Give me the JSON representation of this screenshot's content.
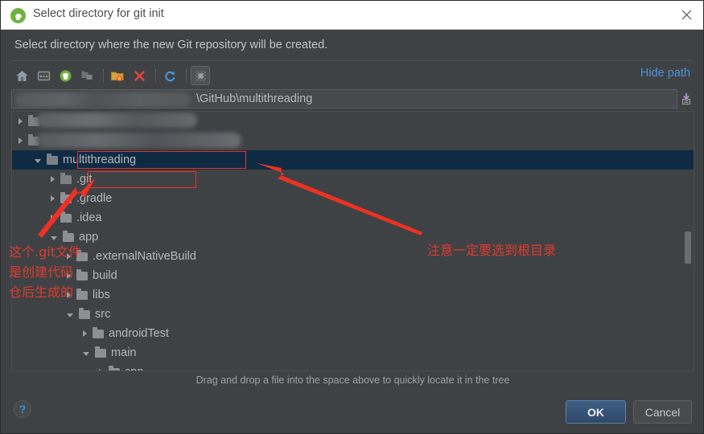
{
  "window": {
    "title": "Select directory for git init",
    "app_icon": "android-studio-icon",
    "close_icon": "close-icon"
  },
  "prompt": "Select directory where the new Git repository will be created.",
  "toolbar": {
    "buttons": [
      {
        "name": "home-icon",
        "tooltip": "Home"
      },
      {
        "name": "desktop-icon",
        "tooltip": "Desktop"
      },
      {
        "name": "project-icon",
        "tooltip": "Project"
      },
      {
        "name": "module-icon",
        "tooltip": "Module"
      },
      {
        "name": "new-folder-icon",
        "tooltip": "New Folder"
      },
      {
        "name": "delete-icon",
        "tooltip": "Delete"
      },
      {
        "name": "refresh-icon",
        "tooltip": "Refresh"
      },
      {
        "name": "show-hidden-icon",
        "tooltip": "Show Hidden Files"
      }
    ],
    "hide_path_label": "Hide path"
  },
  "path": {
    "value": "\\GitHub\\multithreading",
    "redacted_prefix": true,
    "dropdown_icon": "history-dropdown-icon"
  },
  "tree": {
    "rows": [
      {
        "label": "",
        "indent": 0,
        "state": "collapsed",
        "redacted": true,
        "folder": "dim",
        "selected": false
      },
      {
        "label": "",
        "indent": 0,
        "state": "collapsed",
        "redacted": true,
        "folder": "dim",
        "selected": false
      },
      {
        "label": "multithreading",
        "indent": 1,
        "state": "expanded",
        "redacted": false,
        "folder": "dim",
        "selected": true
      },
      {
        "label": ".git",
        "indent": 2,
        "state": "collapsed",
        "redacted": false,
        "folder": "dim",
        "selected": false
      },
      {
        "label": ".gradle",
        "indent": 2,
        "state": "collapsed",
        "redacted": false,
        "folder": "normal",
        "selected": false
      },
      {
        "label": ".idea",
        "indent": 2,
        "state": "collapsed",
        "redacted": false,
        "folder": "normal",
        "selected": false
      },
      {
        "label": "app",
        "indent": 2,
        "state": "expanded",
        "redacted": false,
        "folder": "normal",
        "selected": false
      },
      {
        "label": ".externalNativeBuild",
        "indent": 3,
        "state": "collapsed",
        "redacted": false,
        "folder": "normal",
        "selected": false
      },
      {
        "label": "build",
        "indent": 3,
        "state": "collapsed",
        "redacted": false,
        "folder": "normal",
        "selected": false
      },
      {
        "label": "libs",
        "indent": 3,
        "state": "collapsed",
        "redacted": false,
        "folder": "normal",
        "selected": false
      },
      {
        "label": "src",
        "indent": 3,
        "state": "expanded",
        "redacted": false,
        "folder": "normal",
        "selected": false
      },
      {
        "label": "androidTest",
        "indent": 4,
        "state": "collapsed",
        "redacted": false,
        "folder": "normal",
        "selected": false
      },
      {
        "label": "main",
        "indent": 4,
        "state": "expanded",
        "redacted": false,
        "folder": "normal",
        "selected": false
      },
      {
        "label": "cpp",
        "indent": 5,
        "state": "collapsed",
        "redacted": false,
        "folder": "normal",
        "selected": false
      }
    ]
  },
  "drag_hint": "Drag and drop a file into the space above to quickly locate it in the tree",
  "footer": {
    "help_label": "?",
    "ok_label": "OK",
    "cancel_label": "Cancel"
  },
  "annotations": {
    "left_note": "这个.git文件\n是创建代码\n仓后生成的",
    "right_note": "注意一定要选到根目录",
    "color": "#e03a2f"
  },
  "colors": {
    "dialog_bg": "#3f4244",
    "titlebar_bg": "#ffffff",
    "selection_bg": "#0f2b43",
    "link": "#4b93d8",
    "annotation_red": "#e03a2f",
    "ok_button": "#3d5e85"
  }
}
